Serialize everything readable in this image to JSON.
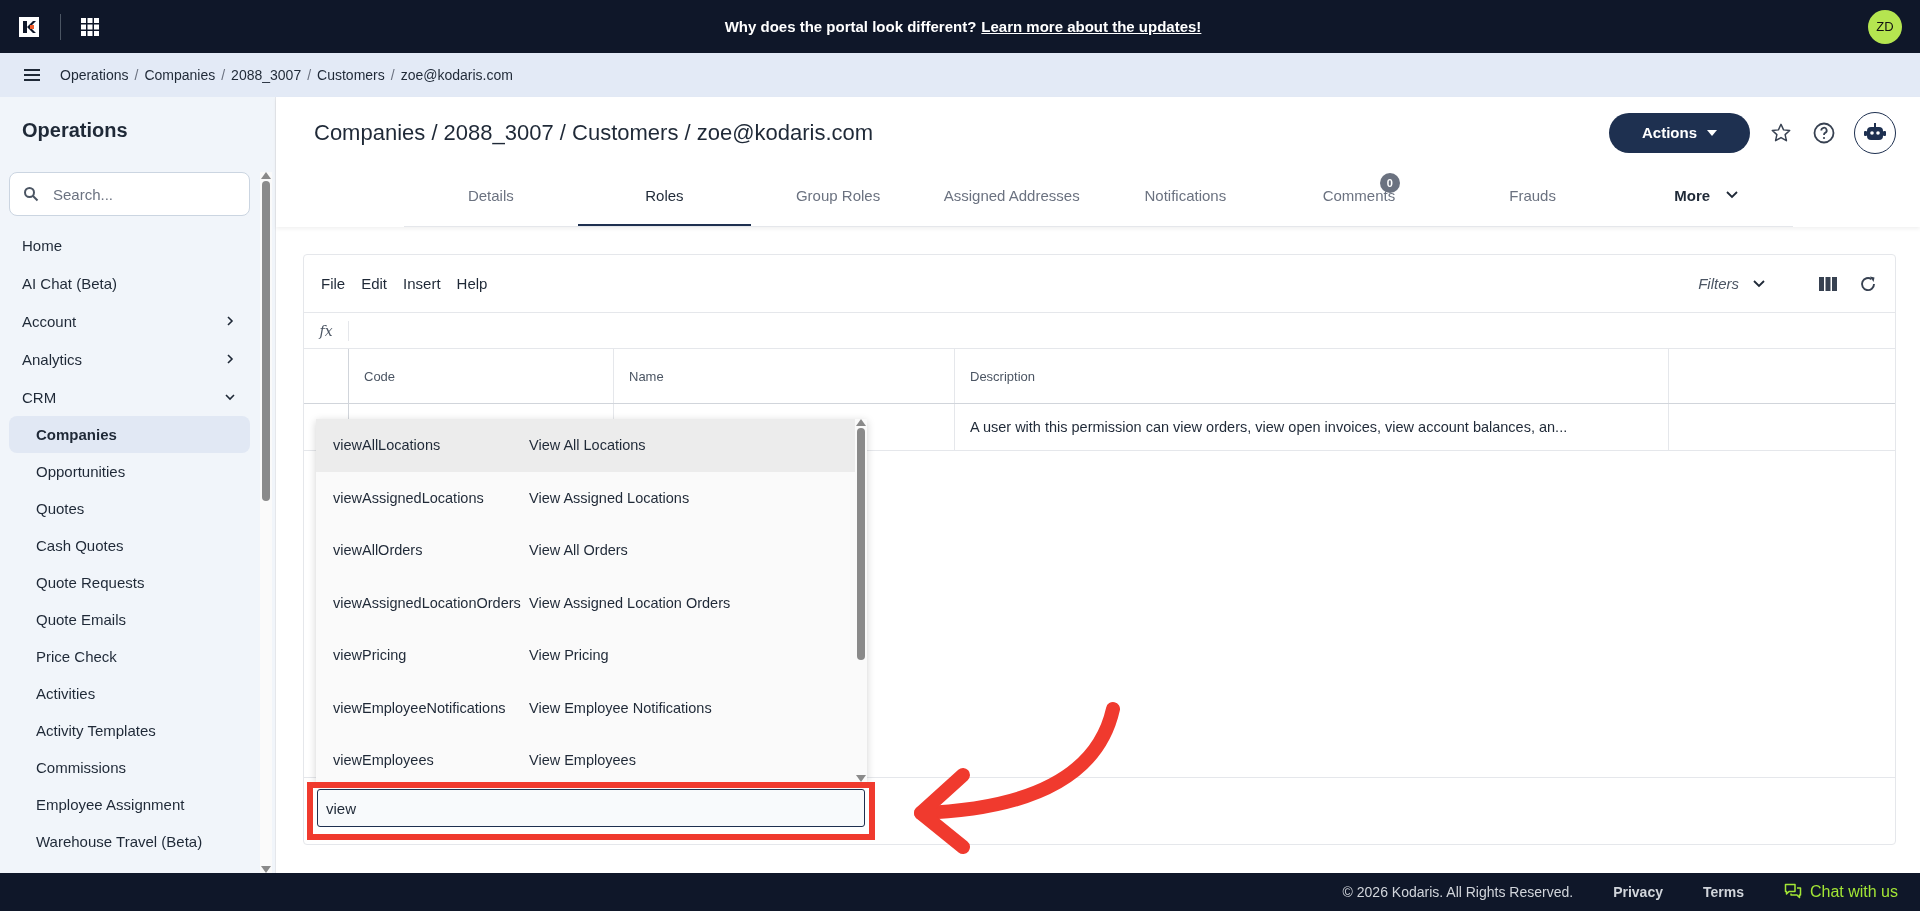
{
  "top_bar": {
    "announcement": "Why does the portal look different?",
    "announcement_link": "Learn more about the updates!",
    "avatar": "ZD"
  },
  "breadcrumb": {
    "separator": "/",
    "items": [
      "Operations",
      "Companies",
      "2088_3007",
      "Customers",
      "zoe@kodaris.com"
    ]
  },
  "sidebar": {
    "title": "Operations",
    "search": {
      "placeholder": "Search..."
    },
    "items": [
      {
        "label": "Home",
        "kind": "link",
        "selected": false
      },
      {
        "label": "AI Chat (Beta)",
        "kind": "link",
        "selected": false
      },
      {
        "label": "Account",
        "kind": "group",
        "expanded": false,
        "selected": false
      },
      {
        "label": "Analytics",
        "kind": "group",
        "expanded": false,
        "selected": false
      },
      {
        "label": "CRM",
        "kind": "group",
        "expanded": true,
        "selected": false,
        "children": [
          {
            "label": "Companies",
            "selected": true
          },
          {
            "label": "Opportunities",
            "selected": false
          },
          {
            "label": "Quotes",
            "selected": false
          },
          {
            "label": "Cash Quotes",
            "selected": false
          },
          {
            "label": "Quote Requests",
            "selected": false
          },
          {
            "label": "Quote Emails",
            "selected": false
          },
          {
            "label": "Price Check",
            "selected": false
          },
          {
            "label": "Activities",
            "selected": false
          },
          {
            "label": "Activity Templates",
            "selected": false
          },
          {
            "label": "Commissions",
            "selected": false
          },
          {
            "label": "Employee Assignment",
            "selected": false
          },
          {
            "label": "Warehouse Travel (Beta)",
            "selected": false
          }
        ]
      }
    ]
  },
  "page": {
    "title": "Companies / 2088_3007 / Customers / zoe@kodaris.com",
    "actions_button": "Actions"
  },
  "tabs": [
    {
      "label": "Details",
      "selected": false
    },
    {
      "label": "Roles",
      "selected": true
    },
    {
      "label": "Group Roles",
      "selected": false
    },
    {
      "label": "Assigned Addresses",
      "selected": false
    },
    {
      "label": "Notifications",
      "selected": false
    },
    {
      "label": "Comments",
      "selected": false,
      "badge": "0"
    },
    {
      "label": "Frauds",
      "selected": false
    },
    {
      "label": "More",
      "selected": false,
      "kind": "menu"
    }
  ],
  "grid": {
    "menu": [
      "File",
      "Edit",
      "Insert",
      "Help"
    ],
    "formula_label": "fx",
    "filters": "Filters",
    "columns": [
      "Code",
      "Name",
      "Description"
    ],
    "rows": [
      {
        "description": "A user with this permission can view orders, view open invoices, view account balances, an..."
      }
    ]
  },
  "editor": {
    "value": "view",
    "options": [
      {
        "code": "viewAllLocations",
        "name": "View All Locations",
        "selected": true
      },
      {
        "code": "viewAssignedLocations",
        "name": "View Assigned Locations",
        "selected": false
      },
      {
        "code": "viewAllOrders",
        "name": "View All Orders",
        "selected": false
      },
      {
        "code": "viewAssignedLocationOrders",
        "name": "View Assigned Location Orders",
        "selected": false
      },
      {
        "code": "viewPricing",
        "name": "View Pricing",
        "selected": false
      },
      {
        "code": "viewEmployeeNotifications",
        "name": "View Employee Notifications",
        "selected": false
      },
      {
        "code": "viewEmployees",
        "name": "View Employees",
        "selected": false
      }
    ]
  },
  "footer": {
    "copyright": "© 2026 Kodaris. All Rights Reserved.",
    "links": [
      "Privacy",
      "Terms"
    ],
    "chat": "Chat with us"
  }
}
